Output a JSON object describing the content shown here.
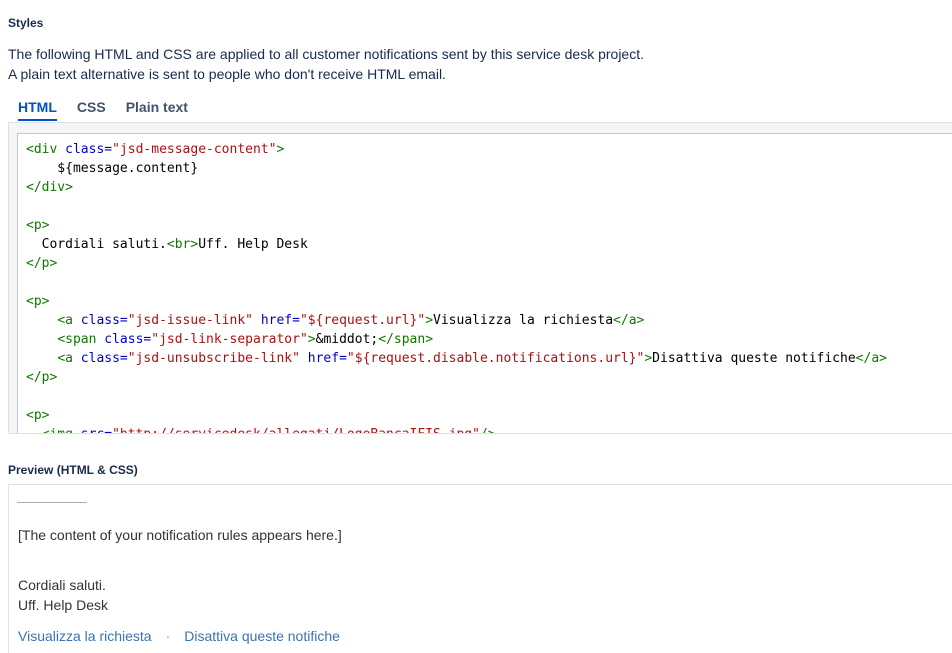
{
  "section": {
    "title": "Styles",
    "description_line1": "The following HTML and CSS are applied to all customer notifications sent by this service desk project.",
    "description_line2": "A plain text alternative is sent to people who don't receive HTML email."
  },
  "tabs": [
    {
      "label": "HTML",
      "active": true
    },
    {
      "label": "CSS",
      "active": false
    },
    {
      "label": "Plain text",
      "active": false
    }
  ],
  "code_lines": [
    [
      [
        "tag",
        "<div "
      ],
      [
        "attr",
        "class="
      ],
      [
        "str",
        "\"jsd-message-content\""
      ],
      [
        "tag",
        ">"
      ]
    ],
    [
      [
        "txt",
        "    ${message.content}"
      ]
    ],
    [
      [
        "tag",
        "</div>"
      ]
    ],
    [],
    [
      [
        "tag",
        "<p>"
      ]
    ],
    [
      [
        "txt",
        "  Cordiali saluti."
      ],
      [
        "tag",
        "<br>"
      ],
      [
        "txt",
        "Uff. Help Desk"
      ]
    ],
    [
      [
        "tag",
        "</p>"
      ]
    ],
    [],
    [
      [
        "tag",
        "<p>"
      ]
    ],
    [
      [
        "txt",
        "    "
      ],
      [
        "tag",
        "<a "
      ],
      [
        "attr",
        "class="
      ],
      [
        "str",
        "\"jsd-issue-link\""
      ],
      [
        "txt",
        " "
      ],
      [
        "attr",
        "href="
      ],
      [
        "str",
        "\"${request.url}\""
      ],
      [
        "tag",
        ">"
      ],
      [
        "txt",
        "Visualizza la richiesta"
      ],
      [
        "tag",
        "</a>"
      ]
    ],
    [
      [
        "txt",
        "    "
      ],
      [
        "tag",
        "<span "
      ],
      [
        "attr",
        "class="
      ],
      [
        "str",
        "\"jsd-link-separator\""
      ],
      [
        "tag",
        ">"
      ],
      [
        "txt",
        "&middot;"
      ],
      [
        "tag",
        "</span>"
      ]
    ],
    [
      [
        "txt",
        "    "
      ],
      [
        "tag",
        "<a "
      ],
      [
        "attr",
        "class="
      ],
      [
        "str",
        "\"jsd-unsubscribe-link\""
      ],
      [
        "txt",
        " "
      ],
      [
        "attr",
        "href="
      ],
      [
        "str",
        "\"${request.disable.notifications.url}\""
      ],
      [
        "tag",
        ">"
      ],
      [
        "txt",
        "Disattiva queste notifiche"
      ],
      [
        "tag",
        "</a>"
      ]
    ],
    [
      [
        "tag",
        "</p>"
      ]
    ],
    [],
    [
      [
        "tag",
        "<p>"
      ]
    ],
    [
      [
        "txt",
        "  "
      ],
      [
        "tag",
        "<img "
      ],
      [
        "attr",
        "src="
      ],
      [
        "str",
        "\"http://servicedesk/allegati/LogoBancaIFIS.jpg\""
      ],
      [
        "tag",
        "/>"
      ]
    ]
  ],
  "preview": {
    "title": "Preview (HTML & CSS)",
    "content_placeholder": "[The content of your notification rules appears here.]",
    "closing_line1": "Cordiali saluti.",
    "closing_line2": "Uff. Help Desk",
    "view_request_link": "Visualizza la richiesta",
    "separator": "·",
    "unsubscribe_link": "Disattiva queste notifiche"
  },
  "colors": {
    "accent": "#0052cc",
    "tag": "#117700",
    "attr": "#0000cc",
    "string": "#aa1111",
    "link": "#3b73af"
  }
}
